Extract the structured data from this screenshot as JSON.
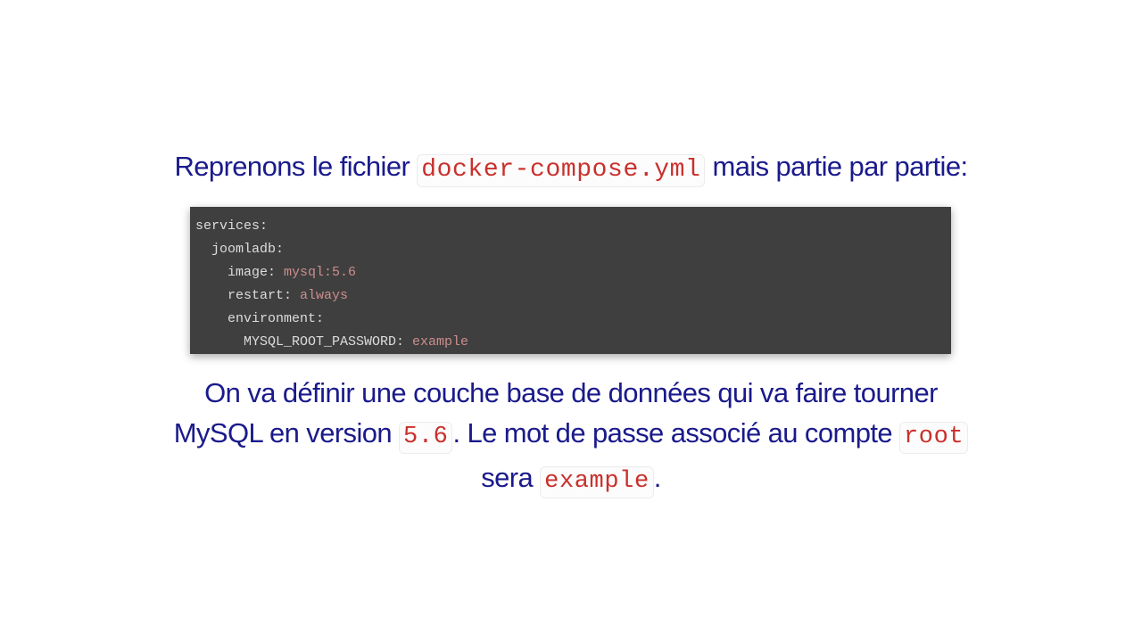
{
  "heading": {
    "before": "Reprenons le fichier ",
    "code": "docker-compose.yml",
    "after": " mais partie par partie:"
  },
  "code_block": {
    "lines": [
      {
        "indent": "",
        "key": "services:",
        "value": ""
      },
      {
        "indent": "  ",
        "key": "joomladb:",
        "value": ""
      },
      {
        "indent": "    ",
        "key": "image: ",
        "value": "mysql:5.6"
      },
      {
        "indent": "    ",
        "key": "restart: ",
        "value": "always"
      },
      {
        "indent": "    ",
        "key": "environment:",
        "value": ""
      },
      {
        "indent": "      ",
        "key": "MYSQL_ROOT_PASSWORD: ",
        "value": "example"
      }
    ]
  },
  "paragraph": {
    "line1": "On va définir une couche base de données qui va faire tourner",
    "line2_before": "MySQL en version ",
    "version_code": "5.6",
    "line2_middle": ". Le mot de passe associé au compte ",
    "root_code": "root",
    "line3_before": "sera ",
    "password_code": "example",
    "line3_after": "."
  },
  "colors": {
    "text": "#1a1a8c",
    "inline_code": "#c9302c",
    "code_bg": "#3f3f3f",
    "code_text": "#dcdcdc",
    "code_value": "#cc8d8d"
  }
}
